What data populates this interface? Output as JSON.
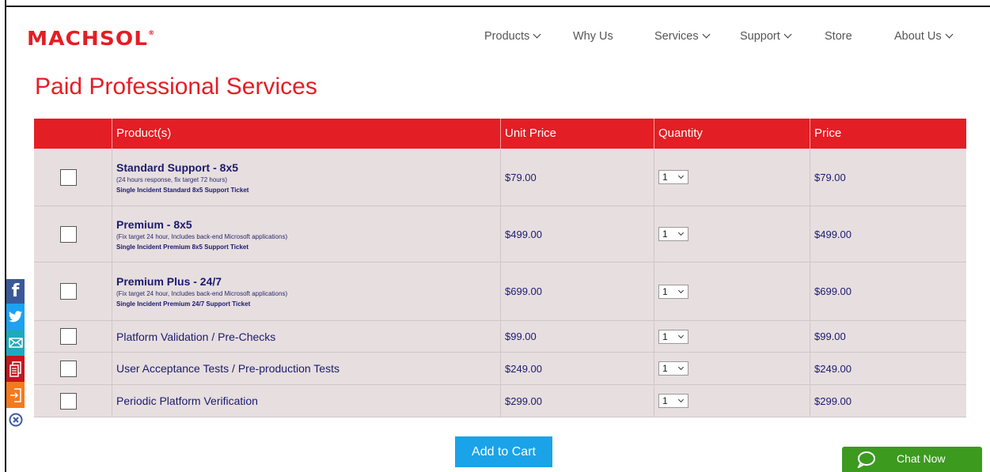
{
  "header": {
    "logo": "MACHSOL",
    "logo_mark": "®",
    "nav": [
      {
        "label": "Products",
        "dropdown": true
      },
      {
        "label": "Why Us",
        "dropdown": false
      },
      {
        "label": "Services",
        "dropdown": true
      },
      {
        "label": "Support",
        "dropdown": true
      },
      {
        "label": "Store",
        "dropdown": false
      },
      {
        "label": "About Us",
        "dropdown": true
      }
    ]
  },
  "page_title": "Paid Professional Services",
  "table": {
    "headers": [
      "",
      "Product(s)",
      "Unit Price",
      "Quantity",
      "Price"
    ],
    "rows": [
      {
        "name": "Standard Support - 8x5",
        "sub": "(24 hours response, fix target 72 hours)",
        "note": "Single Incident Standard 8x5 Support Ticket",
        "unit_price": "$79.00",
        "qty": "1",
        "price": "$79.00"
      },
      {
        "name": "Premium - 8x5",
        "sub": "(Fix target 24 hour, Includes back-end Microsoft applications)",
        "note": "Single Incident Premium 8x5 Support Ticket",
        "unit_price": "$499.00",
        "qty": "1",
        "price": "$499.00"
      },
      {
        "name": "Premium Plus - 24/7",
        "sub": "(Fix target 24 hour, Includes back-end Microsoft applications)",
        "note": "Single Incident Premium 24/7 Support Ticket",
        "unit_price": "$699.00",
        "qty": "1",
        "price": "$699.00"
      },
      {
        "name": "Platform Validation / Pre-Checks",
        "unit_price": "$99.00",
        "qty": "1",
        "price": "$99.00"
      },
      {
        "name": "User Acceptance Tests / Pre-production Tests",
        "unit_price": "$249.00",
        "qty": "1",
        "price": "$249.00"
      },
      {
        "name": "Periodic Platform Verification",
        "unit_price": "$299.00",
        "qty": "1",
        "price": "$299.00"
      }
    ]
  },
  "add_to_cart": "Add to Cart",
  "chat": {
    "label": "Chat Now"
  },
  "colors": {
    "brand_red": "#e31e24",
    "row_bg": "#e7dedf",
    "button_blue": "#1aa3e8",
    "chat_green": "#3c9a1f"
  },
  "social": [
    "facebook-icon",
    "twitter-icon",
    "email-icon",
    "print-icon",
    "share-icon",
    "close-icon"
  ]
}
